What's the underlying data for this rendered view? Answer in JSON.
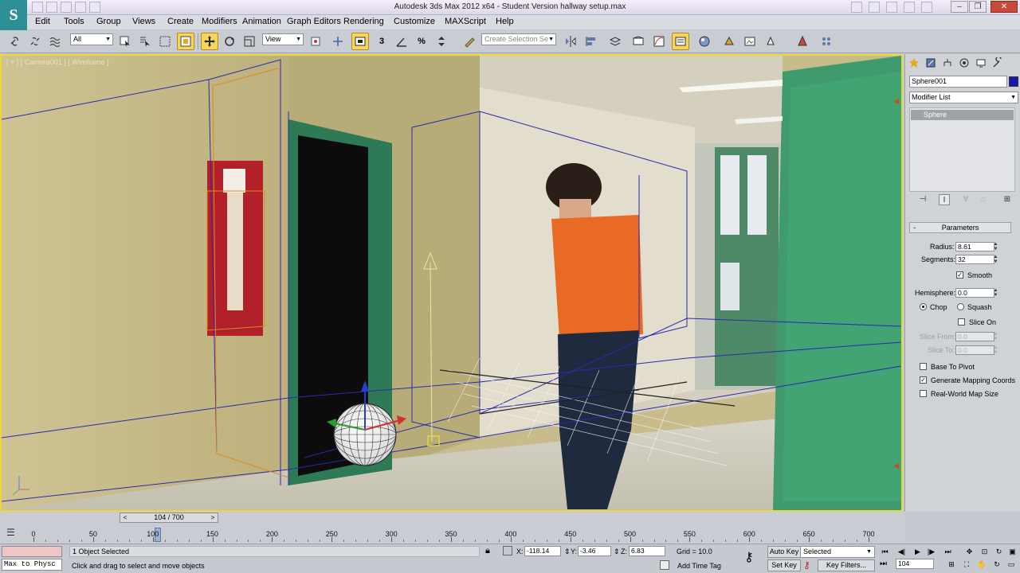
{
  "window": {
    "title": "Autodesk 3ds Max 2012 x64 - Student Version   hallway setup.max",
    "logo": "S",
    "controls": [
      "–",
      "❐",
      "✕"
    ]
  },
  "menu": [
    "Edit",
    "Tools",
    "Group",
    "Views",
    "Create",
    "Modifiers",
    "Animation",
    "Graph Editors",
    "Rendering",
    "Customize",
    "MAXScript",
    "Help"
  ],
  "toolbar": {
    "selection_filter": "All",
    "reference_coord": "View",
    "named_selection_placeholder": "Create Selection Se",
    "snap_label": "3",
    "percent_label": "%"
  },
  "viewport": {
    "label": "[ + ] [ Camera001 ] [ Wireframe ]"
  },
  "command_panel": {
    "object_name": "Sphere001",
    "object_color": "#1219b0",
    "modifier_list": "Modifier List",
    "stack_item": "Sphere",
    "rollout_title": "Parameters",
    "params": {
      "radius_label": "Radius:",
      "radius": "8.61",
      "segments_label": "Segments:",
      "segments": "32",
      "smooth_label": "Smooth",
      "hemisphere_label": "Hemisphere:",
      "hemisphere": "0.0",
      "chop_label": "Chop",
      "squash_label": "Squash",
      "slice_on_label": "Slice On",
      "slice_from_label": "Slice From:",
      "slice_from": "0.0",
      "slice_to_label": "Slice To:",
      "slice_to": "0.0",
      "base_to_pivot_label": "Base To Pivot",
      "gen_mapping_label": "Generate Mapping Coords",
      "real_world_label": "Real-World Map Size"
    }
  },
  "time_slider": {
    "frame_label": "104 / 700",
    "left": "<",
    "right": ">"
  },
  "trackbar": {
    "ticks": [
      "0",
      "50",
      "100",
      "150",
      "200",
      "250",
      "300",
      "350",
      "400",
      "450",
      "500",
      "550",
      "600",
      "650",
      "700"
    ],
    "current_frame": 104
  },
  "status": {
    "maxscript_text": "Max to Physc",
    "selection": "1 Object Selected",
    "prompt": "Click and drag to select and move objects",
    "x_label": "X:",
    "x": "-118.14",
    "y_label": "Y:",
    "y": "-3.46",
    "z_label": "Z:",
    "z": "6.83",
    "grid": "Grid = 10.0",
    "add_time_tag": "Add Time Tag",
    "auto_key": "Auto Key",
    "set_key": "Set Key",
    "selected": "Selected",
    "key_filters": "Key Filters...",
    "frame_field": "104"
  }
}
